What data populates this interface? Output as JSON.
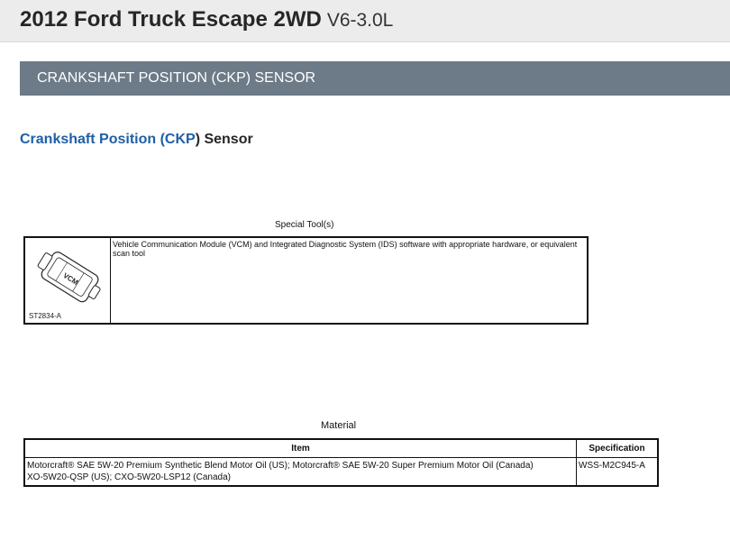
{
  "header": {
    "vehicle": "2012 Ford Truck Escape 2WD",
    "engine": "V6-3.0L"
  },
  "section": {
    "title": "CRANKSHAFT POSITION (CKP) SENSOR"
  },
  "page": {
    "title_part1": "Crankshaft Position (",
    "title_part2": "CKP",
    "title_part3": ") Sensor"
  },
  "special_tools": {
    "caption": "Special Tool(s)",
    "rows": [
      {
        "image_code": "ST2834-A",
        "image_label": "VCM",
        "description": "Vehicle Communication Module (VCM) and Integrated Diagnostic System (IDS) software with appropriate hardware, or equivalent scan tool"
      }
    ]
  },
  "material": {
    "caption": "Material",
    "headers": {
      "item": "Item",
      "specification": "Specification"
    },
    "rows": [
      {
        "item_line1": "Motorcraft® SAE 5W-20 Premium Synthetic Blend Motor Oil (US); Motorcraft® SAE 5W-20 Super Premium Motor Oil (Canada)",
        "item_line2": "XO-5W20-QSP (US); CXO-5W20-LSP12 (Canada)",
        "specification": "WSS-M2C945-A"
      }
    ]
  }
}
